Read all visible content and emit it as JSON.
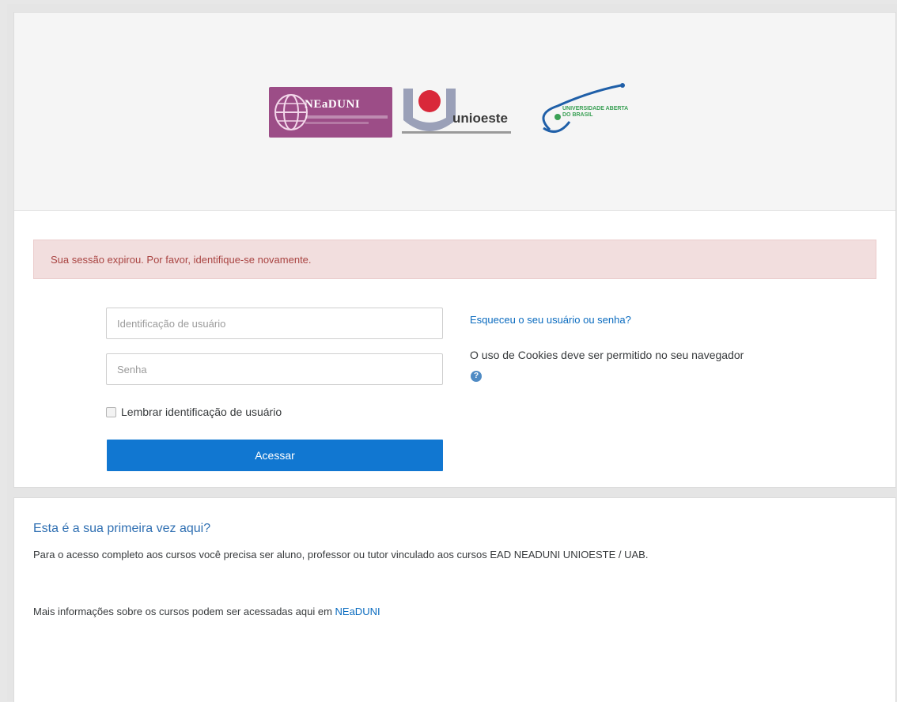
{
  "header": {
    "logos": [
      {
        "name": "NEaDUNI",
        "icon": "neaduni-globe-logo",
        "color": "#9c4d87"
      },
      {
        "name": "unioeste",
        "icon": "unioeste-logo"
      },
      {
        "name": "UNIVERSIDADE ABERTA DO BRASIL",
        "icon": "uab-logo",
        "color": "#1f5fa8"
      }
    ]
  },
  "alert": {
    "message": "Sua sessão expirou. Por favor, identifique-se novamente.",
    "color": "#a94442",
    "background": "#f2dede"
  },
  "login": {
    "username_placeholder": "Identificação de usuário",
    "username_value": "",
    "password_placeholder": "Senha",
    "password_value": "",
    "remember_label": "Lembrar identificação de usuário",
    "remember_checked": false,
    "submit_label": "Acessar",
    "submit_color": "#1177d1"
  },
  "side": {
    "forgot_link": "Esqueceu o seu usuário ou senha?",
    "cookies_text": "O uso de Cookies deve ser permitido no seu navegador",
    "help_icon": "question-circle-icon"
  },
  "info": {
    "title": "Esta é a sua primeira vez aqui?",
    "text": "Para o acesso completo aos cursos você precisa ser aluno, professor ou tutor vinculado aos cursos EAD NEADUNI UNIOESTE / UAB.",
    "more_prefix": "Mais informações sobre os cursos podem ser acessadas aqui em ",
    "more_link": "NEaDUNI"
  }
}
